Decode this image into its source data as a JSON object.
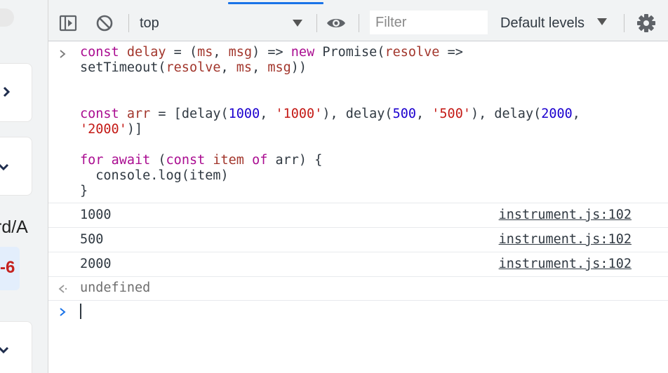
{
  "left_strip": {
    "partial_text": "rd/A",
    "badge_number": "-6"
  },
  "toolbar": {
    "context": "top",
    "filter_placeholder": "Filter",
    "levels_label": "Default levels",
    "icons": [
      "sidebar-toggle-icon",
      "clear-console-icon",
      "eye-icon",
      "gear-icon"
    ]
  },
  "console": {
    "input_lines": [
      {
        "tokens": [
          {
            "t": "const",
            "c": "k"
          },
          {
            "t": " "
          },
          {
            "t": "delay",
            "c": "v"
          },
          {
            "t": " = ("
          },
          {
            "t": "ms",
            "c": "v"
          },
          {
            "t": ", "
          },
          {
            "t": "msg",
            "c": "v"
          },
          {
            "t": ") => "
          },
          {
            "t": "new",
            "c": "k"
          },
          {
            "t": " Promise("
          },
          {
            "t": "resolve",
            "c": "v"
          },
          {
            "t": " =>"
          }
        ]
      },
      {
        "tokens": [
          {
            "t": "setTimeout("
          },
          {
            "t": "resolve",
            "c": "v"
          },
          {
            "t": ", "
          },
          {
            "t": "ms",
            "c": "v"
          },
          {
            "t": ", "
          },
          {
            "t": "msg",
            "c": "v"
          },
          {
            "t": "))"
          }
        ]
      },
      {
        "tokens": []
      },
      {
        "tokens": []
      },
      {
        "tokens": [
          {
            "t": "const",
            "c": "k"
          },
          {
            "t": " "
          },
          {
            "t": "arr",
            "c": "v"
          },
          {
            "t": " = [delay("
          },
          {
            "t": "1000",
            "c": "num"
          },
          {
            "t": ", "
          },
          {
            "t": "'1000'",
            "c": "str"
          },
          {
            "t": "), delay("
          },
          {
            "t": "500",
            "c": "num"
          },
          {
            "t": ", "
          },
          {
            "t": "'500'",
            "c": "str"
          },
          {
            "t": "), delay("
          },
          {
            "t": "2000",
            "c": "num"
          },
          {
            "t": ","
          }
        ]
      },
      {
        "tokens": [
          {
            "t": "'2000'",
            "c": "str"
          },
          {
            "t": ")]"
          }
        ]
      },
      {
        "tokens": []
      },
      {
        "tokens": [
          {
            "t": "for",
            "c": "k"
          },
          {
            "t": " "
          },
          {
            "t": "await",
            "c": "k"
          },
          {
            "t": " ("
          },
          {
            "t": "const",
            "c": "k"
          },
          {
            "t": " "
          },
          {
            "t": "item",
            "c": "v"
          },
          {
            "t": " "
          },
          {
            "t": "of",
            "c": "k"
          },
          {
            "t": " arr) {"
          }
        ]
      },
      {
        "tokens": [
          {
            "t": "  console.log(item)"
          }
        ]
      },
      {
        "tokens": [
          {
            "t": "}"
          }
        ]
      }
    ],
    "logs": [
      {
        "value": "1000",
        "source": "instrument.js:102"
      },
      {
        "value": "500",
        "source": "instrument.js:102"
      },
      {
        "value": "2000",
        "source": "instrument.js:102"
      }
    ],
    "result": "undefined",
    "colors": {
      "keyword": "#aa0d91",
      "variable": "#a2362c",
      "number": "#1c00cf",
      "string": "#c41a16",
      "accent": "#1a73e8"
    }
  }
}
